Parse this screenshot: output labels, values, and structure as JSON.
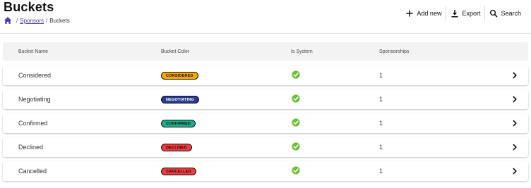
{
  "header": {
    "title": "Buckets",
    "breadcrumb": {
      "home_icon": "home-icon",
      "parent": "Sponsors",
      "separator": "/",
      "current": "Buckets"
    }
  },
  "actions": {
    "add": {
      "label": "Add new",
      "icon": "plus-icon"
    },
    "export": {
      "label": "Export",
      "icon": "download-icon"
    },
    "search": {
      "label": "Search",
      "icon": "search-icon"
    }
  },
  "table": {
    "columns": [
      "Bucket Name",
      "Bucket Color",
      "Is System",
      "Sponsorships"
    ],
    "rows": [
      {
        "name": "Considered",
        "badge": "CONSIDERED",
        "badge_bg": "#f5a800",
        "badge_fg": "#111111",
        "is_system": true,
        "sponsorships": "1"
      },
      {
        "name": "Negotiating",
        "badge": "NEGOTIATING",
        "badge_bg": "#2b3a8f",
        "badge_fg": "#ffffff",
        "is_system": true,
        "sponsorships": "1"
      },
      {
        "name": "Confirmed",
        "badge": "CONFIRMED",
        "badge_bg": "#1fae8c",
        "badge_fg": "#111111",
        "is_system": true,
        "sponsorships": "1"
      },
      {
        "name": "Declined",
        "badge": "DECLINED",
        "badge_bg": "#ef3b3b",
        "badge_fg": "#111111",
        "is_system": true,
        "sponsorships": "1"
      },
      {
        "name": "Cancelled",
        "badge": "CANCELLED",
        "badge_bg": "#ef3b3b",
        "badge_fg": "#111111",
        "is_system": true,
        "sponsorships": "1"
      }
    ]
  },
  "colors": {
    "accent": "#4b3fae",
    "check": "#6fbf3a"
  }
}
